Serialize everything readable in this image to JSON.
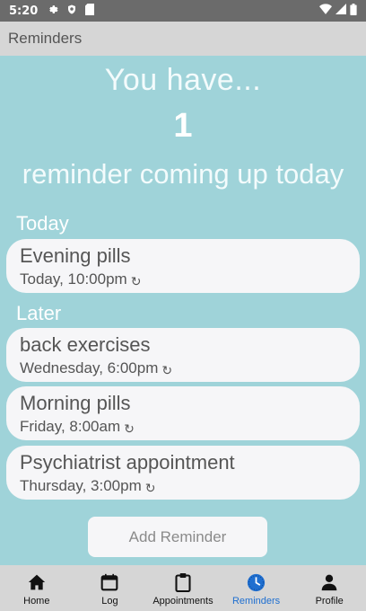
{
  "status_bar": {
    "time": "5:20"
  },
  "app_bar": {
    "title": "Reminders"
  },
  "hero": {
    "line1": "You have...",
    "count": "1",
    "line3": "reminder coming up today"
  },
  "sections": {
    "today": "Today",
    "later": "Later"
  },
  "today_reminders": [
    {
      "name": "Evening pills",
      "when": "Today, 10:00pm"
    }
  ],
  "later_reminders": [
    {
      "name": "back exercises",
      "when": "Wednesday, 6:00pm"
    },
    {
      "name": "Morning pills",
      "when": "Friday, 8:00am"
    },
    {
      "name": "Psychiatrist appointment",
      "when": "Thursday, 3:00pm"
    }
  ],
  "add_button": {
    "label": "Add Reminder"
  },
  "nav": [
    {
      "label": "Home",
      "icon": "home-icon"
    },
    {
      "label": "Log",
      "icon": "calendar-icon"
    },
    {
      "label": "Appointments",
      "icon": "clipboard-icon"
    },
    {
      "label": "Reminders",
      "icon": "clock-icon",
      "active": true
    },
    {
      "label": "Profile",
      "icon": "person-icon"
    }
  ],
  "colors": {
    "background": "#9fd3d9",
    "card": "#f6f6f8",
    "active_nav": "#1f6fd0",
    "status_bar": "#6b6b6b",
    "app_bar": "#d6d6d6"
  }
}
